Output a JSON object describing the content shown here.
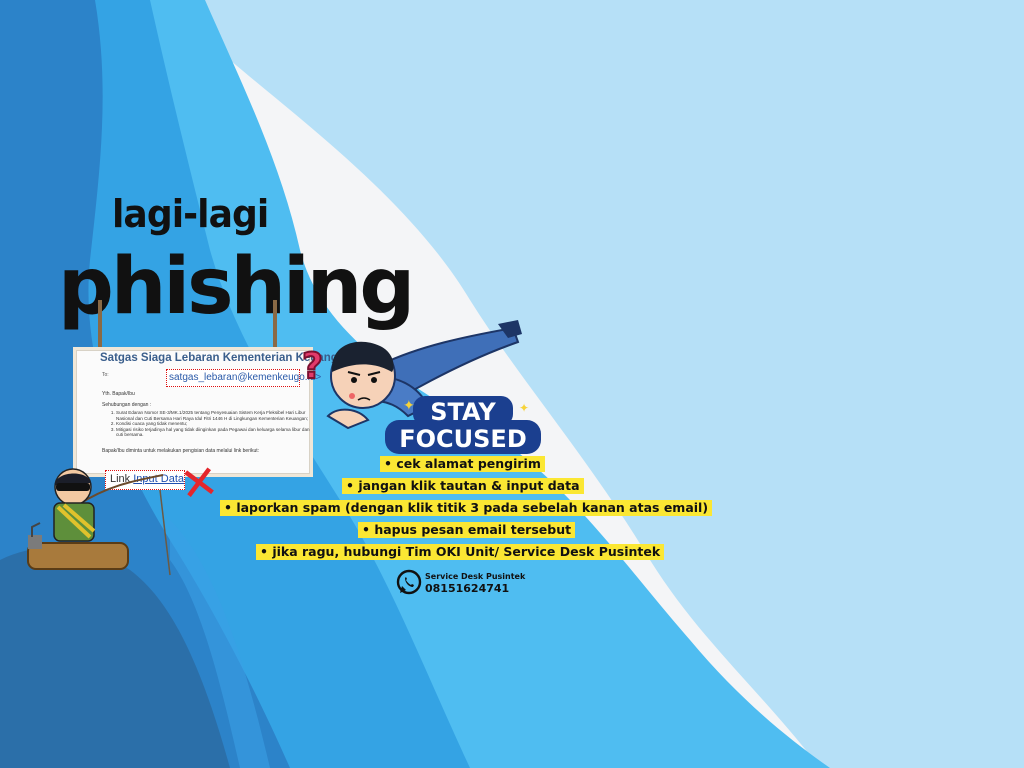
{
  "headline": {
    "line1": "lagi-lagi",
    "line2": "phishing"
  },
  "email": {
    "subject": "Satgas Siaga Lebaran Kementerian Keuangan",
    "to_label": "To:",
    "sender": "satgas_lebaran@kemenkeugo.id>",
    "greeting_label": "Yth. Bapak/Ibu",
    "intro": "Sehubungan dengan :",
    "list": [
      "Surat Edaran Nomor SE-3/MK.1/2025 tentang Penyesuaian Sistem Kerja Fleksibel Hari Libur Nasional dan Cuti Bersama Hari Raya Idul Fitri 1446 H di Lingkungan Kementerian Keuangan;",
      "Kondisi cuaca yang tidak menentu;",
      "Mitigasi risiko terjadinya hal yang tidak diinginkan pada Pegawai dan keluarga selama libur dan cuti bersama."
    ],
    "closing": "Bapak/Ibu diminta untuk melakukan pengisian data melalui link berikut:",
    "link_label": "Link",
    "link_value": "Input Data",
    "warning_mark": "?",
    "reject_mark": "✕"
  },
  "badge": {
    "line1": "STAY",
    "line2": "FOCUSED"
  },
  "tips": [
    "• cek alamat pengirim",
    "• jangan klik tautan & input data",
    "• laporkan spam (dengan klik titik 3 pada sebelah kanan atas email)",
    "• hapus pesan email tersebut",
    "• jika ragu, hubungi Tim OKI Unit/ Service Desk Pusintek"
  ],
  "contact": {
    "icon": "whatsapp-icon",
    "label": "Service Desk Pusintek",
    "number": "08151624741"
  },
  "colors": {
    "wave_dark": "#2f8fd8",
    "wave_mid": "#3fb0f0",
    "wave_light": "#a7dcf6",
    "highlight": "#fbe733",
    "badge_blue": "#1b3f8f",
    "alert_red": "#e4262c"
  }
}
